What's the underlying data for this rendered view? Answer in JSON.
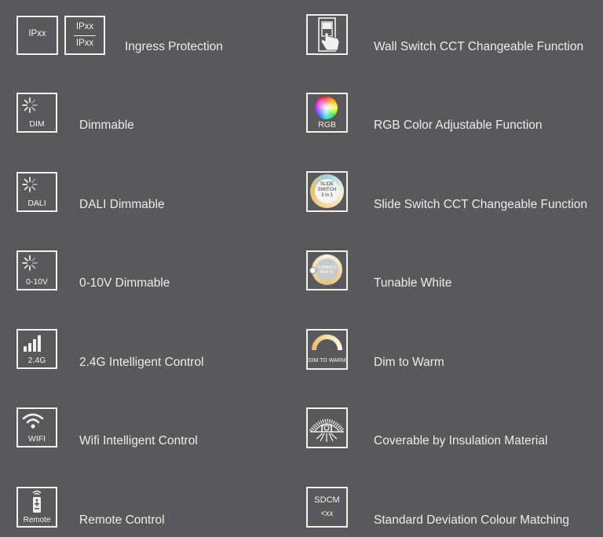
{
  "left": [
    {
      "label": "Ingress Protection",
      "icon": "ip-rating-icon",
      "cap": "IPxx",
      "cap_top": "IPxx",
      "cap_bottom": "IPxx"
    },
    {
      "label": "Dimmable",
      "icon": "dimmable-icon",
      "cap": "DIM"
    },
    {
      "label": "DALI Dimmable",
      "icon": "dali-dimmable-icon",
      "cap": "DALI"
    },
    {
      "label": "0-10V Dimmable",
      "icon": "0-10v-dimmable-icon",
      "cap": "0-10V"
    },
    {
      "label": "2.4G Intelligent Control",
      "icon": "signal-bars-icon",
      "cap": "2.4G"
    },
    {
      "label": "Wifi Intelligent Control",
      "icon": "wifi-icon",
      "cap": "WIFI"
    },
    {
      "label": "Remote Control",
      "icon": "remote-control-icon",
      "cap": "Remote"
    }
  ],
  "right": [
    {
      "label": "Wall Switch CCT Changeable Function",
      "icon": "wall-switch-icon"
    },
    {
      "label": "RGB Color Adjustable Function",
      "icon": "rgb-color-wheel-icon",
      "cap": "RGB"
    },
    {
      "label": "Slide Switch CCT Changeable Function",
      "icon": "slide-switch-icon",
      "cap_lines": [
        "SLIDE",
        "SWITCH",
        "3 in 1"
      ]
    },
    {
      "label": "Tunable White",
      "icon": "tunable-white-icon",
      "cap_lines": [
        "TUNABLE",
        "WHITE"
      ]
    },
    {
      "label": "Dim to Warm",
      "icon": "dim-to-warm-icon",
      "cap": "DIM TO WARM"
    },
    {
      "label": "Coverable by Insulation Material",
      "icon": "insulation-coverable-icon"
    },
    {
      "label": "Standard Deviation Colour Matching",
      "icon": "sdcm-icon",
      "cap_top": "SDCM",
      "cap_bottom": "<xx"
    }
  ]
}
